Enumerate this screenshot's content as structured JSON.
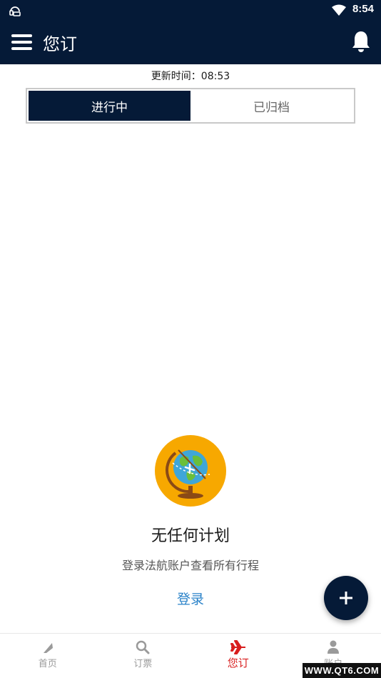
{
  "status_bar": {
    "time": "8:54"
  },
  "app_bar": {
    "title": "您订"
  },
  "updated": "更新时间：08:53",
  "tabs": [
    {
      "label": "进行中",
      "active": true
    },
    {
      "label": "已归档",
      "active": false
    }
  ],
  "empty_state": {
    "title": "无任何计划",
    "subtitle": "登录法航账户查看所有行程",
    "login": "登录"
  },
  "bottom_nav": [
    {
      "label": "首页",
      "icon": "tail-icon"
    },
    {
      "label": "订票",
      "icon": "search-icon"
    },
    {
      "label": "您订",
      "icon": "plane-icon",
      "active": true
    },
    {
      "label": "账户",
      "icon": "person-icon"
    }
  ],
  "watermark": "WWW.QT6.COM",
  "colors": {
    "navy": "#051a37",
    "accent_red": "#d81e1e",
    "link_blue": "#2b83c9",
    "globe_orange": "#f7a800"
  }
}
